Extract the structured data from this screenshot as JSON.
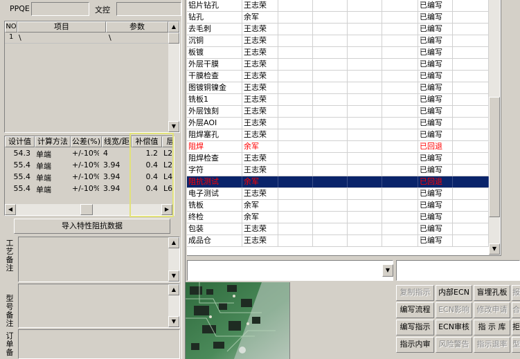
{
  "top": {
    "ppqe_label": "PPQE",
    "ppqe_value": "",
    "control_label": "文控",
    "control_value": ""
  },
  "param_table": {
    "headers": [
      "NO",
      "项目",
      "参数"
    ],
    "rows": [
      {
        "no": "1",
        "item": "\\",
        "param": "\\"
      }
    ]
  },
  "impedance_table": {
    "headers": [
      "设计值",
      "计算方法",
      "公差(%)",
      "线宽/距",
      "补偿值",
      "层"
    ],
    "rows": [
      {
        "design": "54.3",
        "method": "单端",
        "tol": "+/-10%",
        "width": "4",
        "comp": "1.2",
        "layer": "L2"
      },
      {
        "design": "55.4",
        "method": "单端",
        "tol": "+/-10%",
        "width": "3.94",
        "comp": "0.4",
        "layer": "L2"
      },
      {
        "design": "55.4",
        "method": "单端",
        "tol": "+/-10%",
        "width": "3.94",
        "comp": "0.4",
        "layer": "L4"
      },
      {
        "design": "55.4",
        "method": "单端",
        "tol": "+/-10%",
        "width": "3.94",
        "comp": "0.4",
        "layer": "L6"
      }
    ]
  },
  "import_button_label": "导入特性阻抗数据",
  "process_note_label": "工艺备注",
  "model_note_label": "型号备注",
  "order_note_label": "订单备",
  "process_list": {
    "rows": [
      {
        "name": "铝片钻孔",
        "person": "王志荣",
        "status": "已编写",
        "state": "normal"
      },
      {
        "name": "钻孔",
        "person": "余军",
        "status": "已编写",
        "state": "normal"
      },
      {
        "name": "去毛刺",
        "person": "王志荣",
        "status": "已编写",
        "state": "normal"
      },
      {
        "name": "沉铜",
        "person": "王志荣",
        "status": "已编写",
        "state": "normal"
      },
      {
        "name": "板镀",
        "person": "王志荣",
        "status": "已编写",
        "state": "normal"
      },
      {
        "name": "外层干膜",
        "person": "王志荣",
        "status": "已编写",
        "state": "normal"
      },
      {
        "name": "干膜检查",
        "person": "王志荣",
        "status": "已编写",
        "state": "normal"
      },
      {
        "name": "图镀铜镍金",
        "person": "王志荣",
        "status": "已编写",
        "state": "normal"
      },
      {
        "name": "铣板1",
        "person": "王志荣",
        "status": "已编写",
        "state": "normal"
      },
      {
        "name": "外层蚀刻",
        "person": "王志荣",
        "status": "已编写",
        "state": "normal"
      },
      {
        "name": "外层AOI",
        "person": "王志荣",
        "status": "已编写",
        "state": "normal"
      },
      {
        "name": "阻焊塞孔",
        "person": "王志荣",
        "status": "已编写",
        "state": "normal"
      },
      {
        "name": "阻焊",
        "person": "余军",
        "status": "已回退",
        "state": "returned"
      },
      {
        "name": "阻焊检查",
        "person": "王志荣",
        "status": "已编写",
        "state": "normal"
      },
      {
        "name": "字符",
        "person": "王志荣",
        "status": "已编写",
        "state": "normal"
      },
      {
        "name": "阻抗测试",
        "person": "余军",
        "status": "已回退",
        "state": "selected"
      },
      {
        "name": "电子测试",
        "person": "王志荣",
        "status": "已编写",
        "state": "normal"
      },
      {
        "name": "铣板",
        "person": "余军",
        "status": "已编写",
        "state": "normal"
      },
      {
        "name": "终检",
        "person": "余军",
        "status": "已编写",
        "state": "normal"
      },
      {
        "name": "包装",
        "person": "王志荣",
        "status": "已编写",
        "state": "normal"
      },
      {
        "name": "成品仓",
        "person": "王志荣",
        "status": "已编写",
        "state": "normal"
      }
    ]
  },
  "combo_value": "",
  "combo2_value": "",
  "buttons": [
    {
      "label": "复制指示",
      "enabled": false
    },
    {
      "label": "内部ECN",
      "enabled": true
    },
    {
      "label": "盲埋孔板",
      "enabled": true
    },
    {
      "label": "报",
      "enabled": false
    },
    {
      "label": "编写流程",
      "enabled": true
    },
    {
      "label": "ECN影响",
      "enabled": false
    },
    {
      "label": "修改申请",
      "enabled": false
    },
    {
      "label": "合",
      "enabled": false
    },
    {
      "label": "编写指示",
      "enabled": true
    },
    {
      "label": "ECN审核",
      "enabled": true
    },
    {
      "label": "指 示 库",
      "enabled": true
    },
    {
      "label": "拒",
      "enabled": true
    },
    {
      "label": "指示内审",
      "enabled": true
    },
    {
      "label": "风险警告",
      "enabled": false
    },
    {
      "label": "指示退率",
      "enabled": false
    },
    {
      "label": "型",
      "enabled": false
    }
  ],
  "colors": {
    "returned_text": "#ff0000",
    "selected_bg": "#0a246a",
    "highlight_box": "#e6e68a"
  }
}
